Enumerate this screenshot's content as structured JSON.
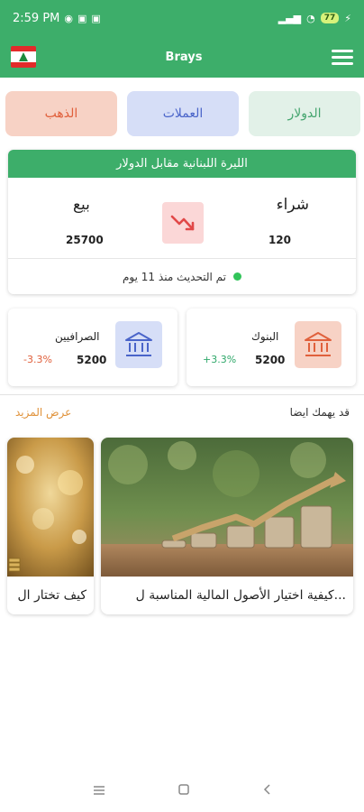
{
  "status_bar": {
    "time": "2:59 PM",
    "battery": "77"
  },
  "app_bar": {
    "title": "Brays"
  },
  "tabs": [
    {
      "label": "الذهب"
    },
    {
      "label": "العملات"
    },
    {
      "label": "الدولار"
    }
  ],
  "rate_card": {
    "title": "الليرة اللبنانية مقابل الدولار",
    "sell_label": "بيع",
    "sell_value": "25700",
    "buy_label": "شراء",
    "buy_value": "120",
    "updated_text": "تم التحديث منذ 11 يوم",
    "trend": "down"
  },
  "exchangers": {
    "title": "الصرافيين",
    "value": "5200",
    "change": "-3.3%"
  },
  "banks": {
    "title": "البنوك",
    "value": "5200",
    "change": "+3.3%"
  },
  "more_section": {
    "title": "قد يهمك ايضا",
    "see_more": "عرض المزيد"
  },
  "articles": [
    {
      "title": "كيفية اختيار الأصول المالية المناسبة ل..."
    },
    {
      "title": "كيف تختار ال"
    }
  ],
  "colors": {
    "primary": "#3dae6a",
    "gold_tab": "#f7d2c5",
    "currency_tab": "#d6def7",
    "dollar_tab": "#e2f1e8",
    "negative": "#e0603c",
    "positive": "#2fa86a"
  }
}
